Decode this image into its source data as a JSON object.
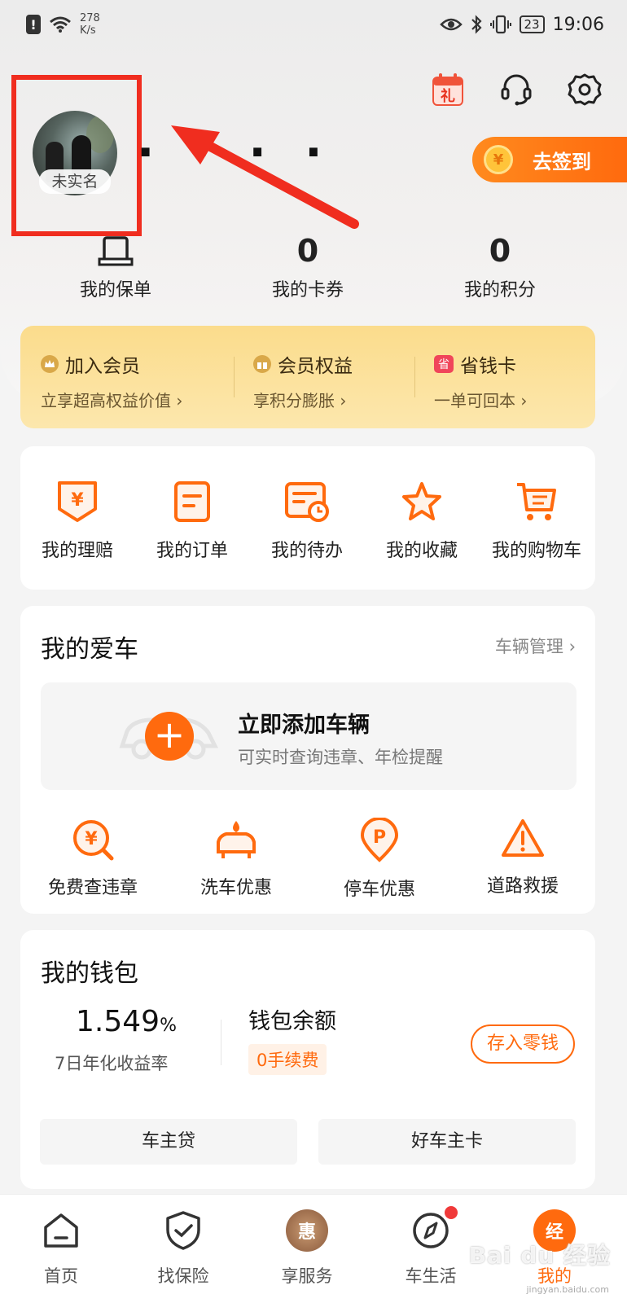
{
  "status_bar": {
    "net_speed_value": "278",
    "net_speed_unit": "K/s",
    "battery": "23",
    "time": "19:06"
  },
  "profile": {
    "avatar_tag": "未实名",
    "username_masked": "· · · ·"
  },
  "signin": {
    "label": "去签到",
    "coin_symbol": "¥"
  },
  "stats": [
    {
      "label": "我的保单"
    },
    {
      "value": "0",
      "label": "我的卡券"
    },
    {
      "value": "0",
      "label": "我的积分"
    }
  ],
  "member": [
    {
      "title": "加入会员",
      "sub": "立享超高权益价值 ›"
    },
    {
      "title": "会员权益",
      "sub": "享积分膨胀 ›"
    },
    {
      "title": "省钱卡",
      "sub": "一单可回本 ›",
      "badge": "省"
    }
  ],
  "quick": [
    {
      "label": "我的理赔",
      "icon": "claim-icon"
    },
    {
      "label": "我的订单",
      "icon": "order-icon"
    },
    {
      "label": "我的待办",
      "icon": "todo-icon"
    },
    {
      "label": "我的收藏",
      "icon": "star-icon"
    },
    {
      "label": "我的购物车",
      "icon": "cart-icon"
    }
  ],
  "car": {
    "title": "我的爱车",
    "manage": "车辆管理 ›",
    "add_title": "立即添加车辆",
    "add_sub": "可实时查询违章、年检提醒",
    "services": [
      {
        "label": "免费查违章",
        "icon": "violation-icon"
      },
      {
        "label": "洗车优惠",
        "icon": "carwash-icon"
      },
      {
        "label": "停车优惠",
        "icon": "parking-icon"
      },
      {
        "label": "道路救援",
        "icon": "warning-icon"
      }
    ]
  },
  "wallet": {
    "title": "我的钱包",
    "yield_value": "1.549",
    "yield_unit": "%",
    "yield_label": "7日年化收益率",
    "balance_title": "钱包余额",
    "fee_tag": "0手续费",
    "deposit": "存入零钱",
    "links": [
      "车主贷",
      "好车主卡"
    ]
  },
  "tabs": [
    {
      "label": "首页",
      "icon": "home-icon"
    },
    {
      "label": "找保险",
      "icon": "shield-icon"
    },
    {
      "label": "享服务",
      "icon": "hui-icon",
      "glyph": "惠"
    },
    {
      "label": "车生活",
      "icon": "compass-icon"
    },
    {
      "label": "我的",
      "icon": "me-icon",
      "glyph": "经"
    }
  ],
  "watermark": {
    "main": "Bai du 经验",
    "sub": "jingyan.baidu.com"
  },
  "colors": {
    "accent": "#ff6a0e",
    "highlight": "#f02d1f",
    "member_gold": "#fbdc8c"
  }
}
